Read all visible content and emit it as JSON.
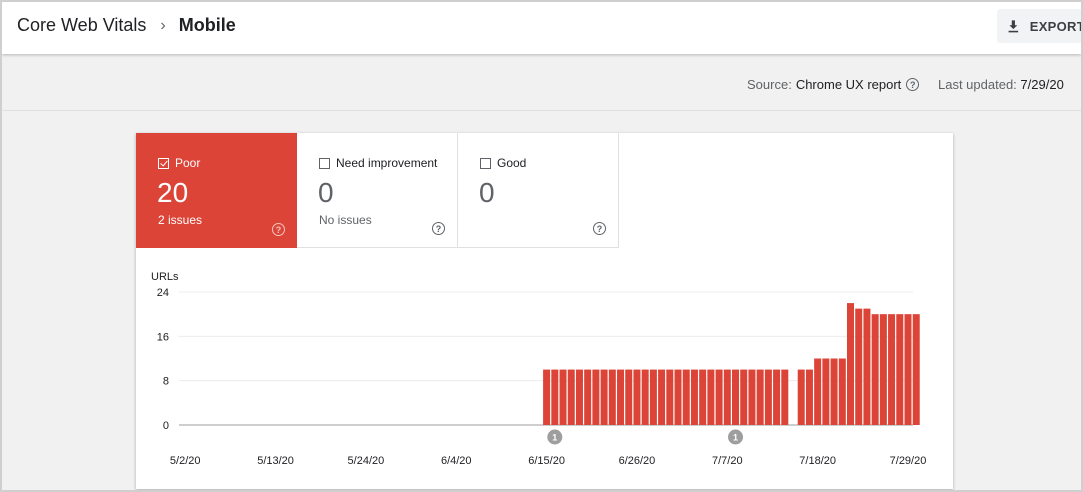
{
  "header": {
    "breadcrumb_root": "Core Web Vitals",
    "breadcrumb_sep": "›",
    "breadcrumb_current": "Mobile",
    "export_label": "EXPORT",
    "export_icon": "download-icon"
  },
  "subbar": {
    "source_label": "Source:",
    "source_value": "Chrome UX report",
    "updated_label": "Last updated:",
    "updated_value": "7/29/20",
    "help_icon": "help-icon"
  },
  "tiles": [
    {
      "label": "Poor",
      "count": "20",
      "issues": "2 issues",
      "checked": true,
      "color": "#db4437"
    },
    {
      "label": "Need improvement",
      "count": "0",
      "issues": "No issues",
      "checked": false
    },
    {
      "label": "Good",
      "count": "0",
      "issues": "",
      "checked": false
    }
  ],
  "chart_data": {
    "type": "bar",
    "ylabel": "URLs",
    "ylim": [
      0,
      24
    ],
    "yticks": [
      0,
      8,
      16,
      24
    ],
    "x_tick_labels": [
      "5/2/20",
      "5/13/20",
      "5/24/20",
      "6/4/20",
      "6/15/20",
      "6/26/20",
      "7/7/20",
      "7/18/20",
      "7/29/20"
    ],
    "categories": [
      "5/1/20",
      "5/2/20",
      "5/3/20",
      "5/4/20",
      "5/5/20",
      "5/6/20",
      "5/7/20",
      "5/8/20",
      "5/9/20",
      "5/10/20",
      "5/11/20",
      "5/12/20",
      "5/13/20",
      "5/14/20",
      "5/15/20",
      "5/16/20",
      "5/17/20",
      "5/18/20",
      "5/19/20",
      "5/20/20",
      "5/21/20",
      "5/22/20",
      "5/23/20",
      "5/24/20",
      "5/25/20",
      "5/26/20",
      "5/27/20",
      "5/28/20",
      "5/29/20",
      "5/30/20",
      "5/31/20",
      "6/1/20",
      "6/2/20",
      "6/3/20",
      "6/4/20",
      "6/5/20",
      "6/6/20",
      "6/7/20",
      "6/8/20",
      "6/9/20",
      "6/10/20",
      "6/11/20",
      "6/12/20",
      "6/13/20",
      "6/14/20",
      "6/15/20",
      "6/16/20",
      "6/17/20",
      "6/18/20",
      "6/19/20",
      "6/20/20",
      "6/21/20",
      "6/22/20",
      "6/23/20",
      "6/24/20",
      "6/25/20",
      "6/26/20",
      "6/27/20",
      "6/28/20",
      "6/29/20",
      "6/30/20",
      "7/1/20",
      "7/2/20",
      "7/3/20",
      "7/4/20",
      "7/5/20",
      "7/6/20",
      "7/7/20",
      "7/8/20",
      "7/9/20",
      "7/10/20",
      "7/11/20",
      "7/12/20",
      "7/13/20",
      "7/14/20",
      "7/15/20",
      "7/16/20",
      "7/17/20",
      "7/18/20",
      "7/19/20",
      "7/20/20",
      "7/21/20",
      "7/22/20",
      "7/23/20",
      "7/24/20",
      "7/25/20",
      "7/26/20",
      "7/27/20",
      "7/28/20",
      "7/29/20"
    ],
    "values": [
      0,
      0,
      0,
      0,
      0,
      0,
      0,
      0,
      0,
      0,
      0,
      0,
      0,
      0,
      0,
      0,
      0,
      0,
      0,
      0,
      0,
      0,
      0,
      0,
      0,
      0,
      0,
      0,
      0,
      0,
      0,
      0,
      0,
      0,
      0,
      0,
      0,
      0,
      0,
      0,
      0,
      0,
      0,
      0,
      0,
      10,
      10,
      10,
      10,
      10,
      10,
      10,
      10,
      10,
      10,
      10,
      10,
      10,
      10,
      10,
      10,
      10,
      10,
      10,
      10,
      10,
      10,
      10,
      10,
      10,
      10,
      10,
      10,
      10,
      10,
      0,
      10,
      10,
      12,
      12,
      12,
      12,
      22,
      21,
      21,
      20,
      20,
      20,
      20,
      20,
      20
    ],
    "series_color": "#db4437",
    "annotations": [
      {
        "date": "6/16/20",
        "label": "1"
      },
      {
        "date": "7/8/20",
        "label": "1"
      }
    ],
    "grid": true,
    "legend": "none"
  }
}
